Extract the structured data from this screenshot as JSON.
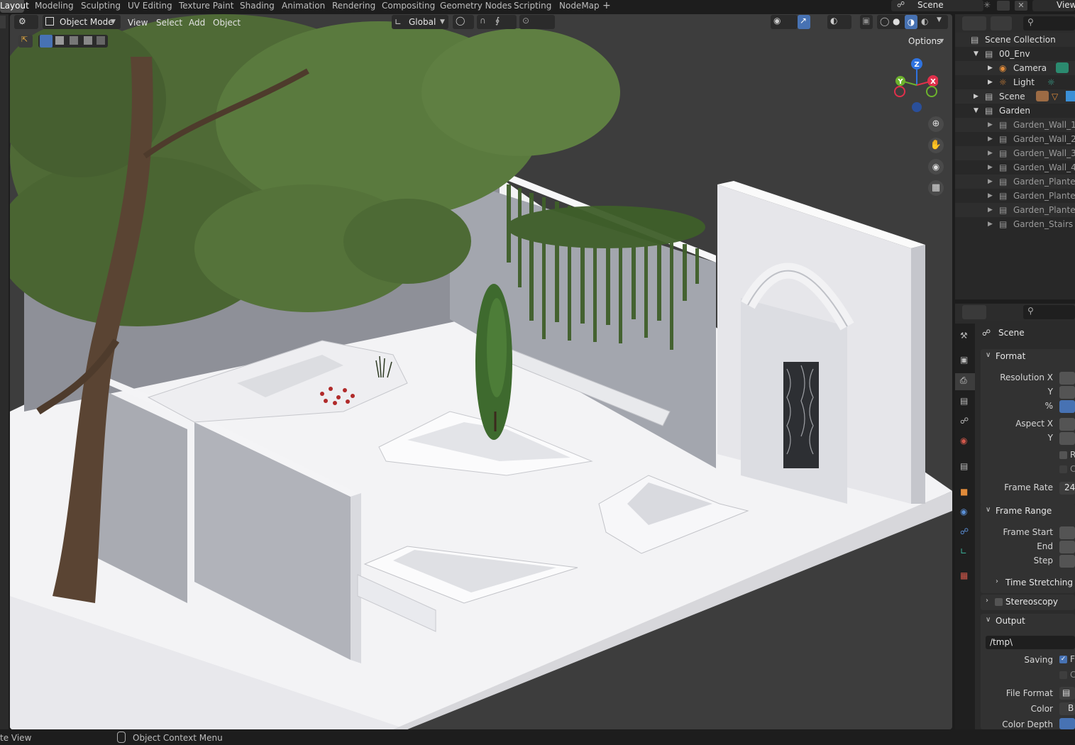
{
  "workspace_tabs": [
    "Layout",
    "Modeling",
    "Sculpting",
    "UV Editing",
    "Texture Paint",
    "Shading",
    "Animation",
    "Rendering",
    "Compositing",
    "Geometry Nodes",
    "Scripting",
    "NodeMap"
  ],
  "scene_selector": "Scene",
  "view_layer": "View",
  "viewport_header": {
    "mode": "Object Mode",
    "menus": [
      "View",
      "Select",
      "Add",
      "Object"
    ],
    "transform_orientation": "Global",
    "options_label": "Options"
  },
  "gizmo": {
    "z": "Z",
    "x": "X",
    "y": "Y"
  },
  "outliner": {
    "items": [
      {
        "label": "Scene Collection",
        "depth": 0
      },
      {
        "label": "00_Env",
        "depth": 1
      },
      {
        "label": "Camera",
        "depth": 2
      },
      {
        "label": "Light",
        "depth": 2
      },
      {
        "label": "Scene",
        "depth": 1
      },
      {
        "label": "Garden",
        "depth": 1
      },
      {
        "label": "Garden_Wall_1",
        "depth": 2
      },
      {
        "label": "Garden_Wall_2",
        "depth": 2
      },
      {
        "label": "Garden_Wall_3",
        "depth": 2
      },
      {
        "label": "Garden_Wall_4",
        "depth": 2
      },
      {
        "label": "Garden_Planters_",
        "depth": 2
      },
      {
        "label": "Garden_Planters_",
        "depth": 2
      },
      {
        "label": "Garden_Planters_",
        "depth": 2
      },
      {
        "label": "Garden_Stairs",
        "depth": 2
      }
    ]
  },
  "properties": {
    "context": "Scene",
    "format_section": "Format",
    "resolution_x": "Resolution X",
    "res_y": "Y",
    "percent": "%",
    "aspect_x": "Aspect X",
    "aspect_y": "Y",
    "frame_rate_label": "Frame Rate",
    "frame_rate_value": "24",
    "frame_range_section": "Frame Range",
    "frame_start": "Frame Start",
    "frame_end": "End",
    "frame_step": "Step",
    "time_stretching": "Time Stretching",
    "stereoscopy": "Stereoscopy",
    "output_section": "Output",
    "output_path": "/tmp\\",
    "saving_label": "Saving",
    "file_format_label": "File Format",
    "color_label": "Color",
    "color_value": "B",
    "color_depth_label": "Color Depth",
    "cb_r": "R",
    "cb_c": "C",
    "cb_f": "F"
  },
  "statusbar": {
    "left": "te View",
    "context_menu": "Object Context Menu"
  },
  "colors": {
    "accent_blue": "#4772b3",
    "gizmo_z": "#2f73e0",
    "gizmo_x": "#e0304b",
    "gizmo_y": "#6db32d"
  }
}
